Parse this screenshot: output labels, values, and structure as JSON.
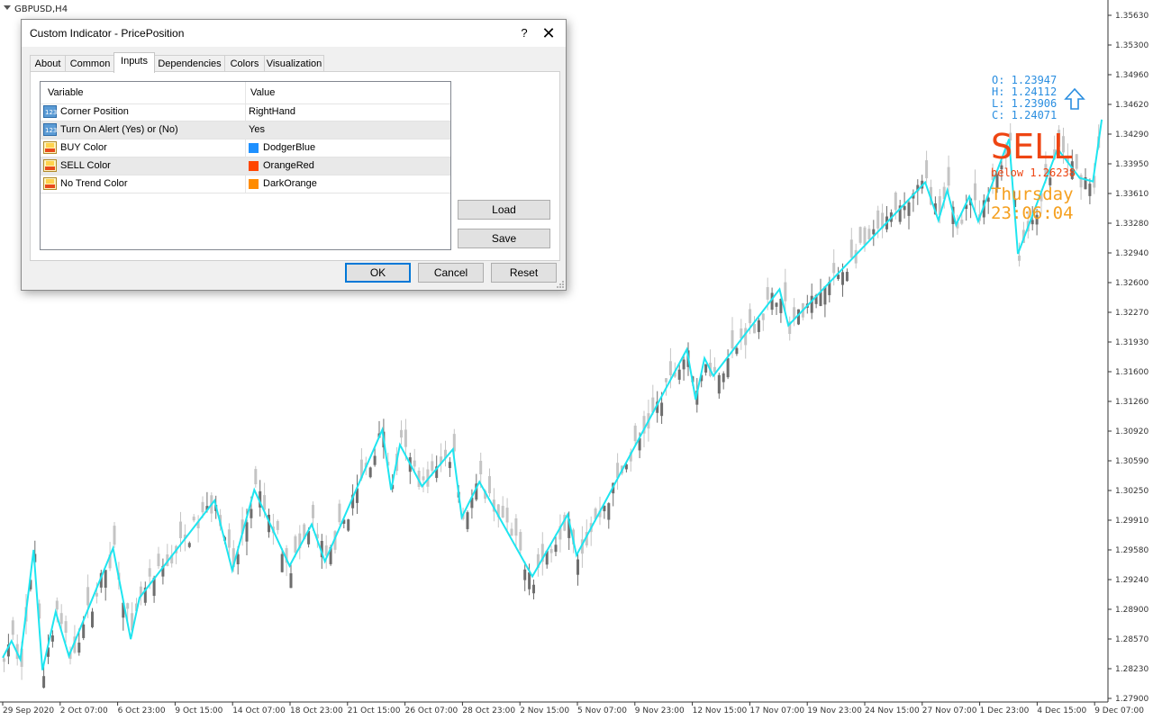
{
  "chart": {
    "symbol_label": "GBPUSD,H4",
    "price_ticks": [
      "1.35630",
      "1.35300",
      "1.34960",
      "1.34620",
      "1.34290",
      "1.33950",
      "1.33610",
      "1.33280",
      "1.32940",
      "1.32600",
      "1.32270",
      "1.31930",
      "1.31600",
      "1.31260",
      "1.30920",
      "1.30590",
      "1.30250",
      "1.29910",
      "1.29580",
      "1.29240",
      "1.28900",
      "1.28570",
      "1.28230",
      "1.27900"
    ],
    "time_ticks": [
      "29 Sep 2020",
      "2 Oct 07:00",
      "6 Oct 23:00",
      "9 Oct 15:00",
      "14 Oct 07:00",
      "18 Oct 23:00",
      "21 Oct 15:00",
      "26 Oct 07:00",
      "28 Oct 23:00",
      "2 Nov 15:00",
      "5 Nov 07:00",
      "9 Nov 23:00",
      "12 Nov 15:00",
      "17 Nov 07:00",
      "19 Nov 23:00",
      "24 Nov 15:00",
      "27 Nov 07:00",
      "1 Dec 23:00",
      "4 Dec 15:00",
      "9 Dec 07:00"
    ],
    "y_range": [
      1.279,
      1.3563
    ],
    "zigzag_color": "#1ee5f0",
    "zigzag": [
      [
        0,
        1.2836
      ],
      [
        2,
        1.2855
      ],
      [
        4,
        1.2834
      ],
      [
        7,
        1.2958
      ],
      [
        9,
        1.2822
      ],
      [
        12,
        1.2888
      ],
      [
        15,
        1.2838
      ],
      [
        25,
        1.296
      ],
      [
        29,
        1.2857
      ],
      [
        31,
        1.2904
      ],
      [
        48,
        1.3014
      ],
      [
        52,
        1.2935
      ],
      [
        57,
        1.3026
      ],
      [
        65,
        1.294
      ],
      [
        70,
        1.2987
      ],
      [
        73,
        1.2945
      ],
      [
        86,
        1.3094
      ],
      [
        88,
        1.3026
      ],
      [
        90,
        1.3077
      ],
      [
        95,
        1.303
      ],
      [
        102,
        1.3072
      ],
      [
        104,
        1.2995
      ],
      [
        108,
        1.3035
      ],
      [
        120,
        1.2928
      ],
      [
        128,
        1.2998
      ],
      [
        130,
        1.2952
      ],
      [
        155,
        1.3185
      ],
      [
        157,
        1.3128
      ],
      [
        159,
        1.3175
      ],
      [
        161,
        1.3155
      ],
      [
        176,
        1.3253
      ],
      [
        178,
        1.3212
      ],
      [
        209,
        1.3374
      ],
      [
        212,
        1.3331
      ],
      [
        214,
        1.3365
      ],
      [
        216,
        1.3326
      ],
      [
        219,
        1.3358
      ],
      [
        221,
        1.333
      ],
      [
        228,
        1.3423
      ],
      [
        230,
        1.3293
      ],
      [
        239,
        1.3412
      ],
      [
        244,
        1.3379
      ],
      [
        247,
        1.3375
      ],
      [
        249,
        1.3445
      ]
    ],
    "indicator": {
      "ohlc": [
        "O: 1.23947",
        "H: 1.24112",
        "L: 1.23906",
        "C: 1.24071"
      ],
      "arrow_color": "#2a8ee0",
      "signal": "SELL",
      "signal_color": "#ee4513",
      "below_text": "below 1.26238",
      "day": "Thursday",
      "time": "23:06:04",
      "day_color": "#f5a020"
    }
  },
  "dialog": {
    "title": "Custom Indicator - PricePosition",
    "help": "?",
    "close": "✕",
    "tabs": [
      "About",
      "Common",
      "Inputs",
      "Dependencies",
      "Colors",
      "Visualization"
    ],
    "active_tab": "Inputs",
    "columns": {
      "variable": "Variable",
      "value": "Value"
    },
    "rows": [
      {
        "variable": "Corner Position",
        "value": "RightHand",
        "icon": "number-param-icon"
      },
      {
        "variable": "Turn On Alert (Yes) or (No)",
        "value": "Yes",
        "icon": "number-param-icon"
      },
      {
        "variable": "BUY Color",
        "value": "DodgerBlue",
        "icon": "color-param-icon",
        "color": "#1e90ff"
      },
      {
        "variable": "SELL Color",
        "value": "OrangeRed",
        "icon": "color-param-icon",
        "color": "#ff4500"
      },
      {
        "variable": "No Trend Color",
        "value": "DarkOrange",
        "icon": "color-param-icon",
        "color": "#ff8c00"
      }
    ],
    "buttons": {
      "load": "Load",
      "save": "Save",
      "ok": "OK",
      "cancel": "Cancel",
      "reset": "Reset"
    }
  }
}
